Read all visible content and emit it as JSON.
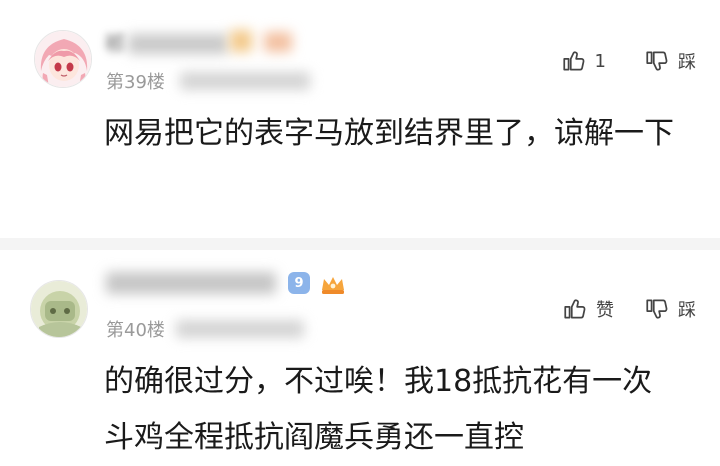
{
  "comments": [
    {
      "username": "祁",
      "floor": "第39楼",
      "likes": "1",
      "dislike_label": "踩",
      "content": "网易把它的表字马放到结界里了，谅解一下"
    },
    {
      "username": "",
      "level": "9",
      "floor": "第40楼",
      "like_label": "赞",
      "dislike_label": "踩",
      "content": "的确很过分，不过唉！我18抵抗花有一次斗鸡全程抵抗阎魔兵勇还一直控"
    }
  ],
  "colors": {
    "text": "#1a1a1a",
    "meta": "#9a9a9a",
    "divider": "#f4f4f4",
    "level_badge": "#8cb4ea"
  }
}
